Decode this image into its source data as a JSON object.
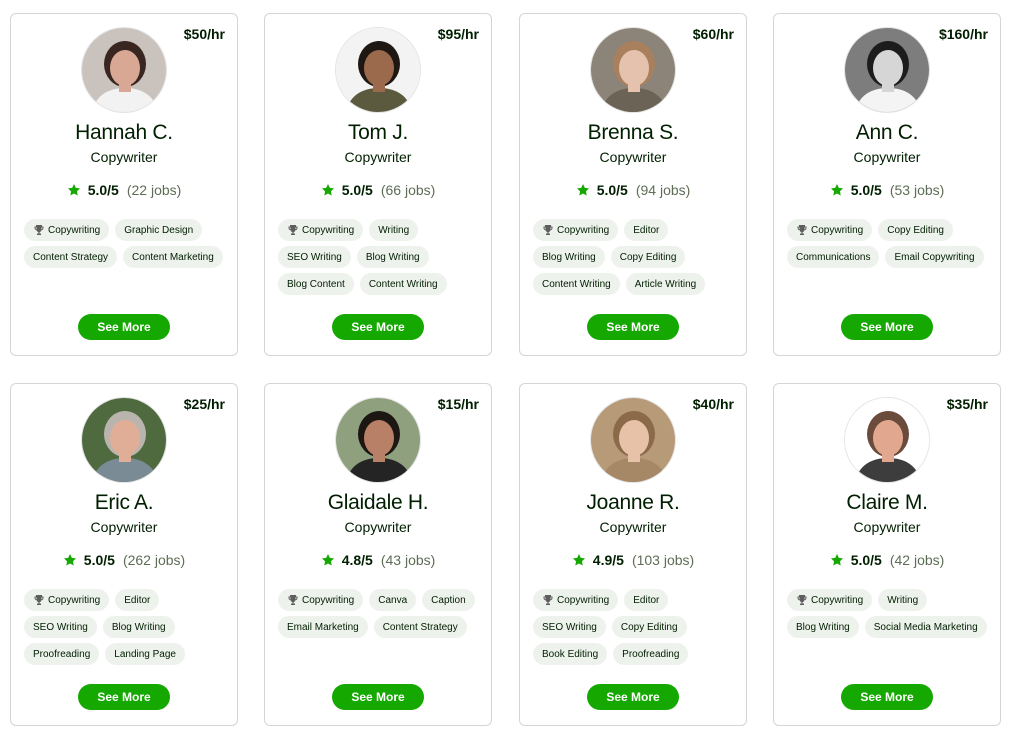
{
  "colors": {
    "accent": "#14a800",
    "star": "#14a800",
    "chip_bg": "#eef2ec",
    "border": "#d5d5d5"
  },
  "freelancers": [
    {
      "rate": "$50/hr",
      "name": "Hannah C.",
      "title": "Copywriter",
      "score": "5.0/5",
      "jobs": "(22 jobs)",
      "skills": [
        "Copywriting",
        "Graphic Design",
        "Content Strategy",
        "Content Marketing"
      ],
      "button": "See More",
      "avatar": {
        "bg": "#c9c2bd",
        "hair": "#3a2621",
        "skin": "#d9a894",
        "shirt": "#f2f2f2"
      }
    },
    {
      "rate": "$95/hr",
      "name": "Tom J.",
      "title": "Copywriter",
      "score": "5.0/5",
      "jobs": "(66 jobs)",
      "skills": [
        "Copywriting",
        "Writing",
        "SEO Writing",
        "Blog Writing",
        "Blog Content",
        "Content Writing"
      ],
      "button": "See More",
      "avatar": {
        "bg": "#f3f3f3",
        "hair": "#1f1712",
        "skin": "#9b6a4d",
        "shirt": "#5c5a3e"
      }
    },
    {
      "rate": "$60/hr",
      "name": "Brenna S.",
      "title": "Copywriter",
      "score": "5.0/5",
      "jobs": "(94 jobs)",
      "skills": [
        "Copywriting",
        "Editor",
        "Blog Writing",
        "Copy Editing",
        "Content Writing",
        "Article Writing"
      ],
      "button": "See More",
      "avatar": {
        "bg": "#8c8478",
        "hair": "#a8805e",
        "skin": "#e5c2ad",
        "shirt": "#6b6356"
      }
    },
    {
      "rate": "$160/hr",
      "name": "Ann C.",
      "title": "Copywriter",
      "score": "5.0/5",
      "jobs": "(53 jobs)",
      "skills": [
        "Copywriting",
        "Copy Editing",
        "Communications",
        "Email Copywriting"
      ],
      "button": "See More",
      "avatar": {
        "bg": "#7d7d7d",
        "hair": "#1c1c1c",
        "skin": "#d6d6d6",
        "shirt": "#f4f4f4"
      }
    },
    {
      "rate": "$25/hr",
      "name": "Eric A.",
      "title": "Copywriter",
      "score": "5.0/5",
      "jobs": "(262 jobs)",
      "skills": [
        "Copywriting",
        "Editor",
        "SEO Writing",
        "Blog Writing",
        "Proofreading",
        "Landing Page"
      ],
      "button": "See More",
      "avatar": {
        "bg": "#4f6a3e",
        "hair": "#b9b5ae",
        "skin": "#e0ae97",
        "shirt": "#7a8b95"
      }
    },
    {
      "rate": "$15/hr",
      "name": "Glaidale H.",
      "title": "Copywriter",
      "score": "4.8/5",
      "jobs": "(43 jobs)",
      "skills": [
        "Copywriting",
        "Canva",
        "Caption",
        "Email Marketing",
        "Content Strategy"
      ],
      "button": "See More",
      "avatar": {
        "bg": "#8fa07e",
        "hair": "#1d1714",
        "skin": "#b88067",
        "shirt": "#242424"
      }
    },
    {
      "rate": "$40/hr",
      "name": "Joanne R.",
      "title": "Copywriter",
      "score": "4.9/5",
      "jobs": "(103 jobs)",
      "skills": [
        "Copywriting",
        "Editor",
        "SEO Writing",
        "Copy Editing",
        "Book Editing",
        "Proofreading"
      ],
      "button": "See More",
      "avatar": {
        "bg": "#b79a78",
        "hair": "#8a6a49",
        "skin": "#e8c2a8",
        "shirt": "#a68866"
      }
    },
    {
      "rate": "$35/hr",
      "name": "Claire M.",
      "title": "Copywriter",
      "score": "5.0/5",
      "jobs": "(42 jobs)",
      "skills": [
        "Copywriting",
        "Writing",
        "Blog Writing",
        "Social Media Marketing"
      ],
      "button": "See More",
      "avatar": {
        "bg": "#ffffff",
        "hair": "#6b4b3c",
        "skin": "#e1a88f",
        "shirt": "#3d3d3d"
      }
    }
  ]
}
